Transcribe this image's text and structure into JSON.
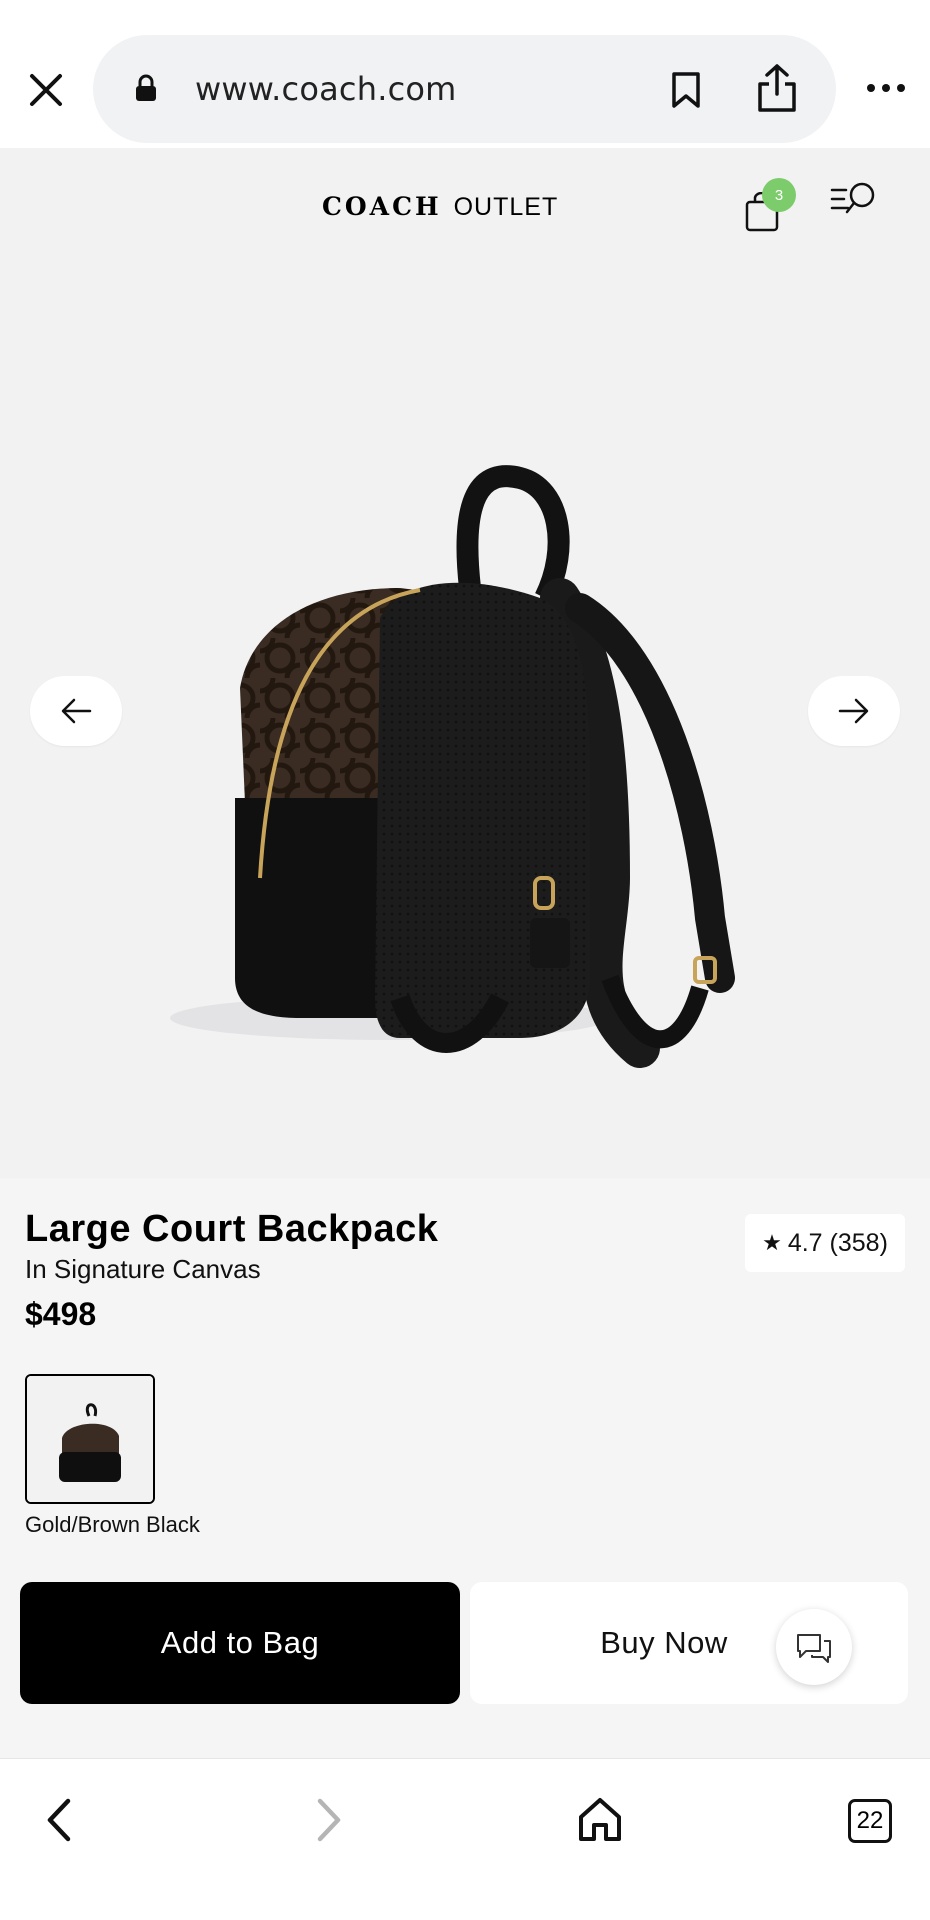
{
  "browser": {
    "url": "www.coach.com",
    "tab_count": "22"
  },
  "site": {
    "logo_brand": "COACH",
    "logo_sub": "OUTLET",
    "bag_count": "3"
  },
  "product": {
    "title": "Large Court Backpack",
    "subtitle": "In Signature Canvas",
    "price": "$498",
    "rating": "4.7 (358)",
    "color_name": "Gold/Brown Black"
  },
  "actions": {
    "add_to_bag": "Add to Bag",
    "buy_now": "Buy Now"
  },
  "icons": {
    "close": "close-icon",
    "lock": "lock-icon",
    "bookmark": "bookmark-icon",
    "share": "share-icon",
    "more": "more-icon",
    "bag": "shopping-bag-icon",
    "menu_search": "menu-search-icon",
    "prev": "arrow-left-icon",
    "next": "arrow-right-icon",
    "chat": "chat-icon",
    "back": "chevron-left-icon",
    "forward": "chevron-right-icon",
    "home": "home-icon"
  },
  "colors": {
    "badge": "#7ccc6c",
    "primary_button": "#000000",
    "hero_bg": "#f2f2f3"
  }
}
